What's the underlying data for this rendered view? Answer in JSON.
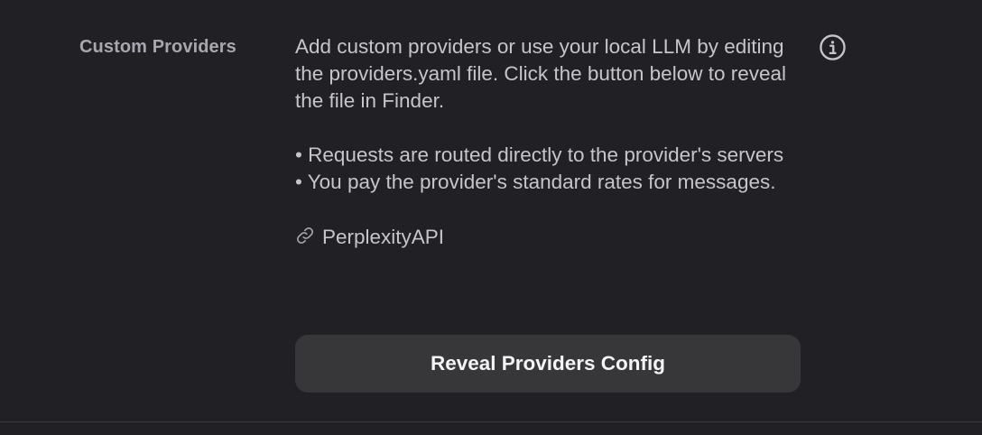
{
  "section": {
    "label": "Custom Providers",
    "description": "Add custom providers or use your local LLM by editing the providers.yaml file. Click the button below to reveal the file in Finder.",
    "bullets": [
      "• Requests are routed directly to the provider's servers",
      "• You pay the provider's standard rates for messages."
    ],
    "provider": {
      "icon": "link-icon",
      "name": "PerplexityAPI"
    },
    "button_label": "Reveal Providers Config",
    "info_icon": "info-icon"
  },
  "colors": {
    "background": "#212024",
    "label_text": "#a8a7ad",
    "body_text": "#c6c5ca",
    "button_bg": "#373639",
    "button_text": "#f4f3f6",
    "divider": "#3a393d"
  }
}
